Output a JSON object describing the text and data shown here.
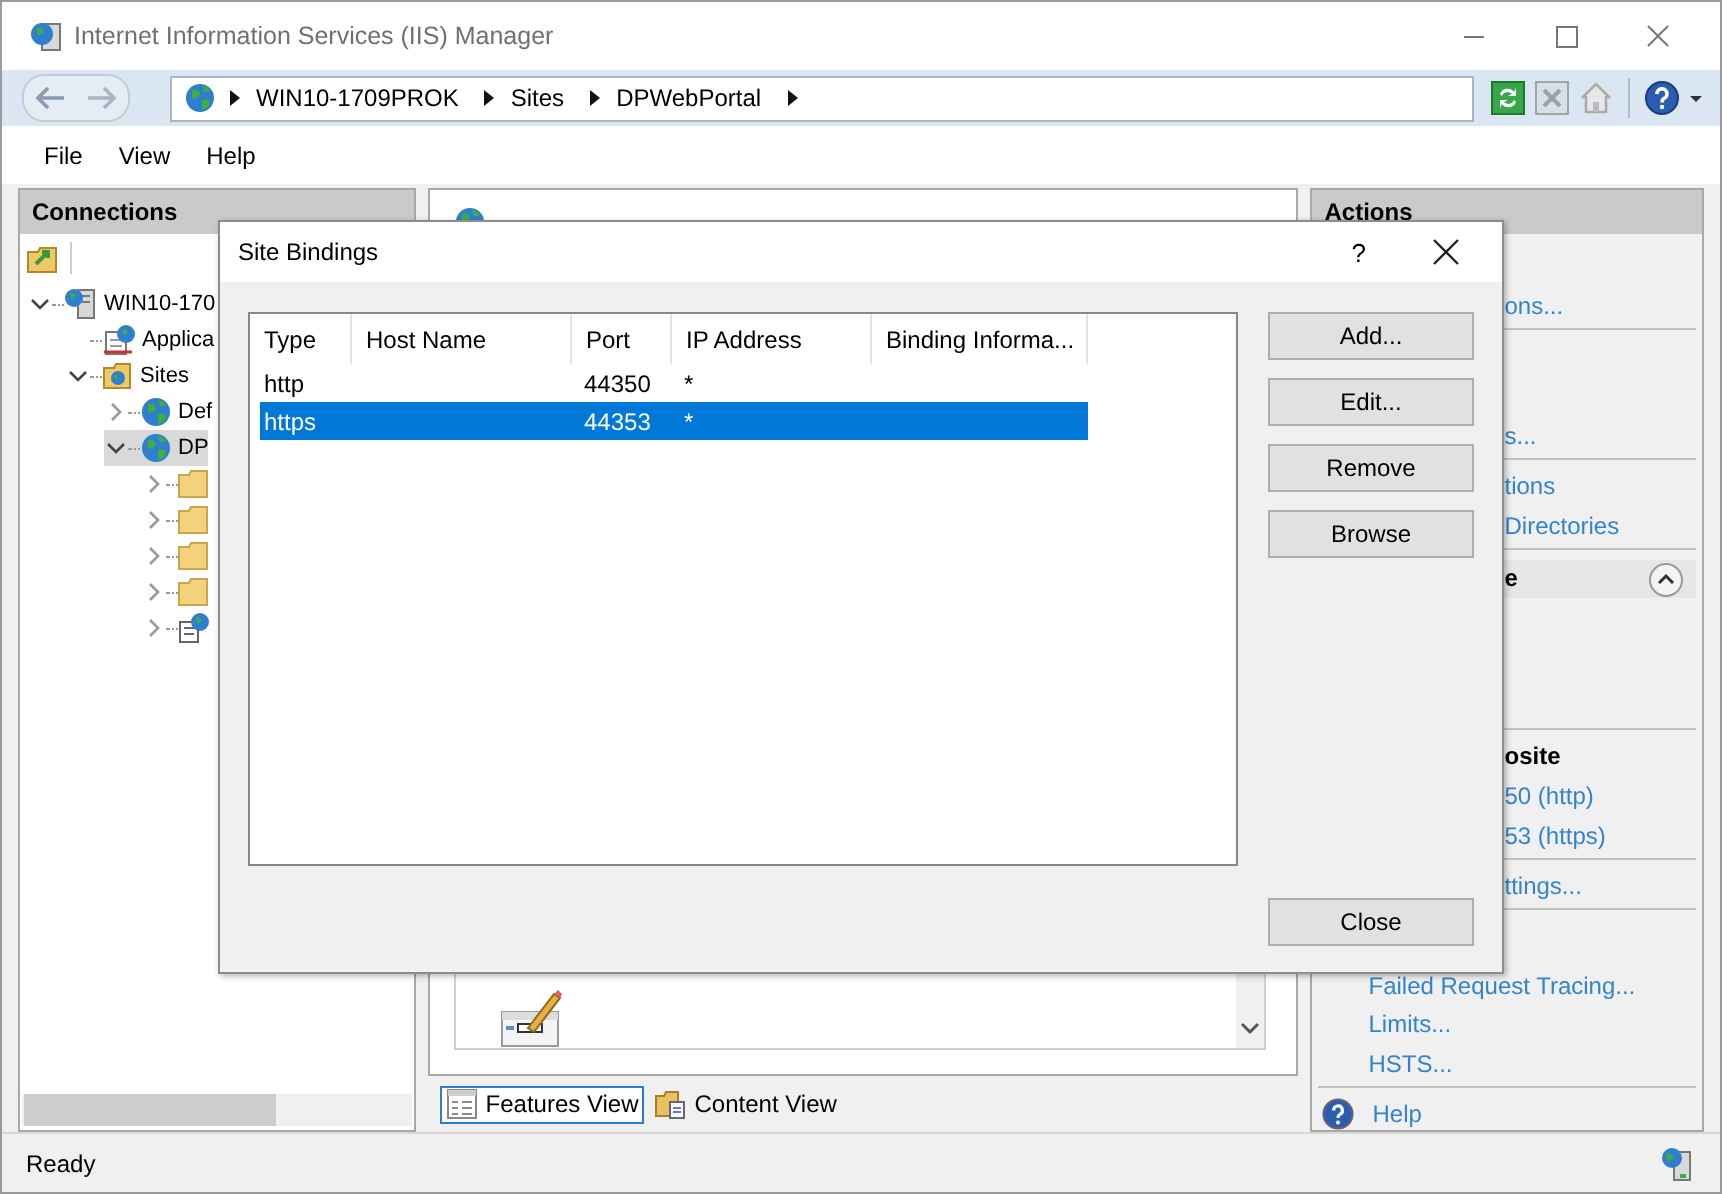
{
  "window": {
    "title": "Internet Information Services (IIS) Manager"
  },
  "address_bar": {
    "segments": [
      "WIN10-1709PROK",
      "Sites",
      "DPWebPortal"
    ]
  },
  "toolbar": [
    {
      "kind": "refresh",
      "disabled": false
    },
    {
      "kind": "stop",
      "disabled": true
    },
    {
      "kind": "home",
      "disabled": false
    },
    {
      "kind": "help",
      "disabled": false
    }
  ],
  "menu": [
    "File",
    "View",
    "Help"
  ],
  "connections": {
    "title": "Connections",
    "tree": [
      {
        "label": "WIN10-170",
        "kind": "server",
        "expanded": true,
        "selected": false,
        "children": [
          {
            "label": "Applica",
            "kind": "pool",
            "selected": false
          },
          {
            "label": "Sites",
            "kind": "sites",
            "expanded": true,
            "selected": false,
            "children": [
              {
                "label": "Def",
                "kind": "globe",
                "expanded": false,
                "selected": false
              },
              {
                "label": "DP",
                "kind": "globe",
                "expanded": true,
                "selected": true,
                "children": [
                  {
                    "kind": "folder",
                    "expanded": false,
                    "selected": false
                  },
                  {
                    "kind": "folder",
                    "expanded": false,
                    "selected": false
                  },
                  {
                    "kind": "folder",
                    "expanded": false,
                    "selected": false
                  },
                  {
                    "kind": "folder",
                    "expanded": false,
                    "selected": false
                  },
                  {
                    "kind": "webdoc",
                    "expanded": false,
                    "selected": false
                  }
                ]
              }
            ]
          }
        ]
      }
    ]
  },
  "view_tabs": [
    {
      "label": "Features View",
      "selected": true
    },
    {
      "label": "Content View",
      "selected": false
    }
  ],
  "actions": {
    "title": "Actions",
    "items": [
      {
        "kind": "link",
        "text": "ons...",
        "partial": true
      },
      {
        "kind": "divider"
      },
      {
        "kind": "link",
        "text": "s...",
        "partial": true
      },
      {
        "kind": "divider"
      },
      {
        "kind": "link",
        "text": "tions",
        "partial": true
      },
      {
        "kind": "link",
        "text": "Directories",
        "partial": true
      },
      {
        "kind": "divider"
      },
      {
        "kind": "section",
        "text": "e",
        "partial": true
      },
      {
        "kind": "divider"
      },
      {
        "kind": "heading",
        "text": "osite",
        "partial": true
      },
      {
        "kind": "link",
        "text": "50 (http)",
        "partial": true
      },
      {
        "kind": "link",
        "text": "53 (https)",
        "partial": true
      },
      {
        "kind": "divider"
      },
      {
        "kind": "link",
        "text": "ttings...",
        "partial": true
      },
      {
        "kind": "divider"
      },
      {
        "kind": "link",
        "text": "Failed Request Tracing...",
        "partial": false
      },
      {
        "kind": "link",
        "text": "Limits...",
        "partial": false
      },
      {
        "kind": "link",
        "text": "HSTS...",
        "partial": false
      },
      {
        "kind": "divider"
      },
      {
        "kind": "help",
        "text": "Help",
        "partial": false
      }
    ]
  },
  "status_bar": {
    "text": "Ready"
  },
  "dialog": {
    "title": "Site Bindings",
    "help": "?",
    "columns": [
      "Type",
      "Host Name",
      "Port",
      "IP Address",
      "Binding Informa..."
    ],
    "rows": [
      {
        "type": "http",
        "port": "44350",
        "ip_address": "*",
        "selected": false
      },
      {
        "type": "https",
        "port": "44353",
        "ip_address": "*",
        "selected": true
      }
    ],
    "buttons": [
      "Add...",
      "Edit...",
      "Remove",
      "Browse"
    ],
    "close_button": "Close"
  }
}
